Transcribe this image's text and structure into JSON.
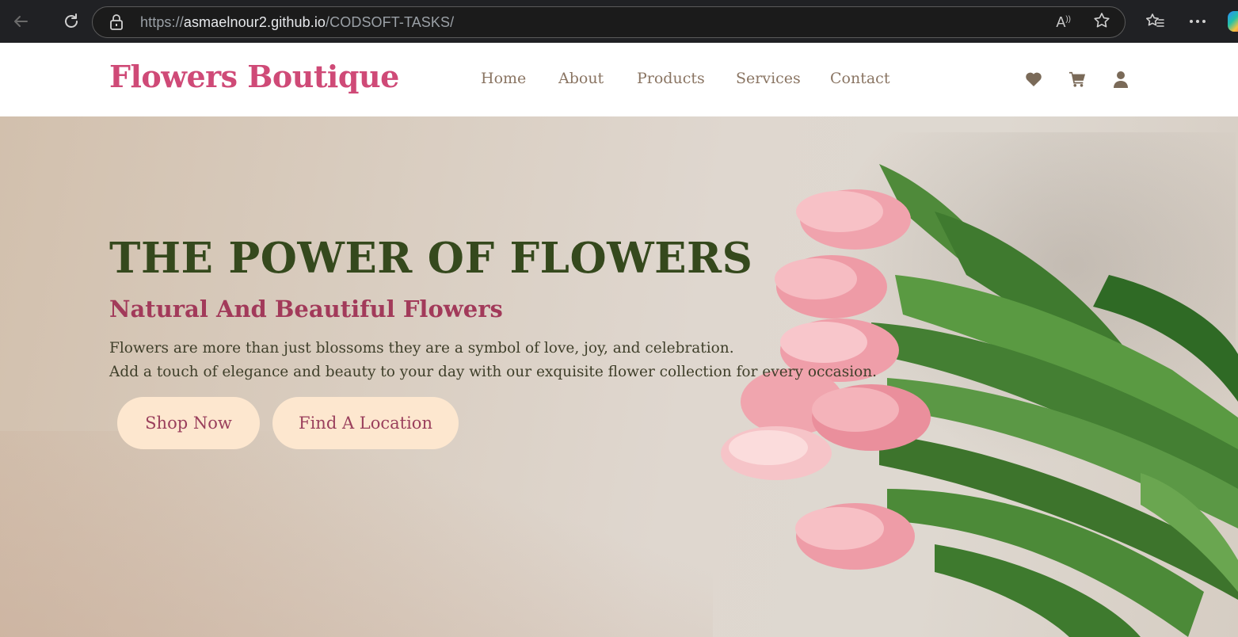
{
  "browser": {
    "url_prefix": "https://",
    "url_host": "asmaelnour2.github.io",
    "url_path": "/CODSOFT-TASKS/",
    "read_aloud_label": "A",
    "icons": [
      "back-arrow-icon",
      "reload-icon",
      "lock-icon",
      "read-aloud-icon",
      "favorite-star-icon",
      "favorites-list-icon",
      "more-menu-icon",
      "copilot-icon"
    ]
  },
  "header": {
    "logo": "Flowers Boutique",
    "nav": [
      "Home",
      "About",
      "Products",
      "Services",
      "Contact"
    ],
    "icons": [
      "heart-icon",
      "cart-icon",
      "user-icon"
    ]
  },
  "hero": {
    "title": "THE POWER OF FLOWERS",
    "subtitle": "Natural And Beautiful Flowers",
    "line1": "Flowers are more than just blossoms they are a symbol of love, joy, and celebration.",
    "line2": "Add a touch of elegance and beauty to your day with our exquisite flower collection for every occasion.",
    "buttons": [
      "Shop Now",
      "Find A Location"
    ]
  },
  "colors": {
    "logo": "#cf4a77",
    "nav": "#8a7563",
    "title": "#35491d",
    "subtitle": "#a23a5a",
    "button_bg": "#fde7cf",
    "button_text": "#9a3f5c"
  }
}
